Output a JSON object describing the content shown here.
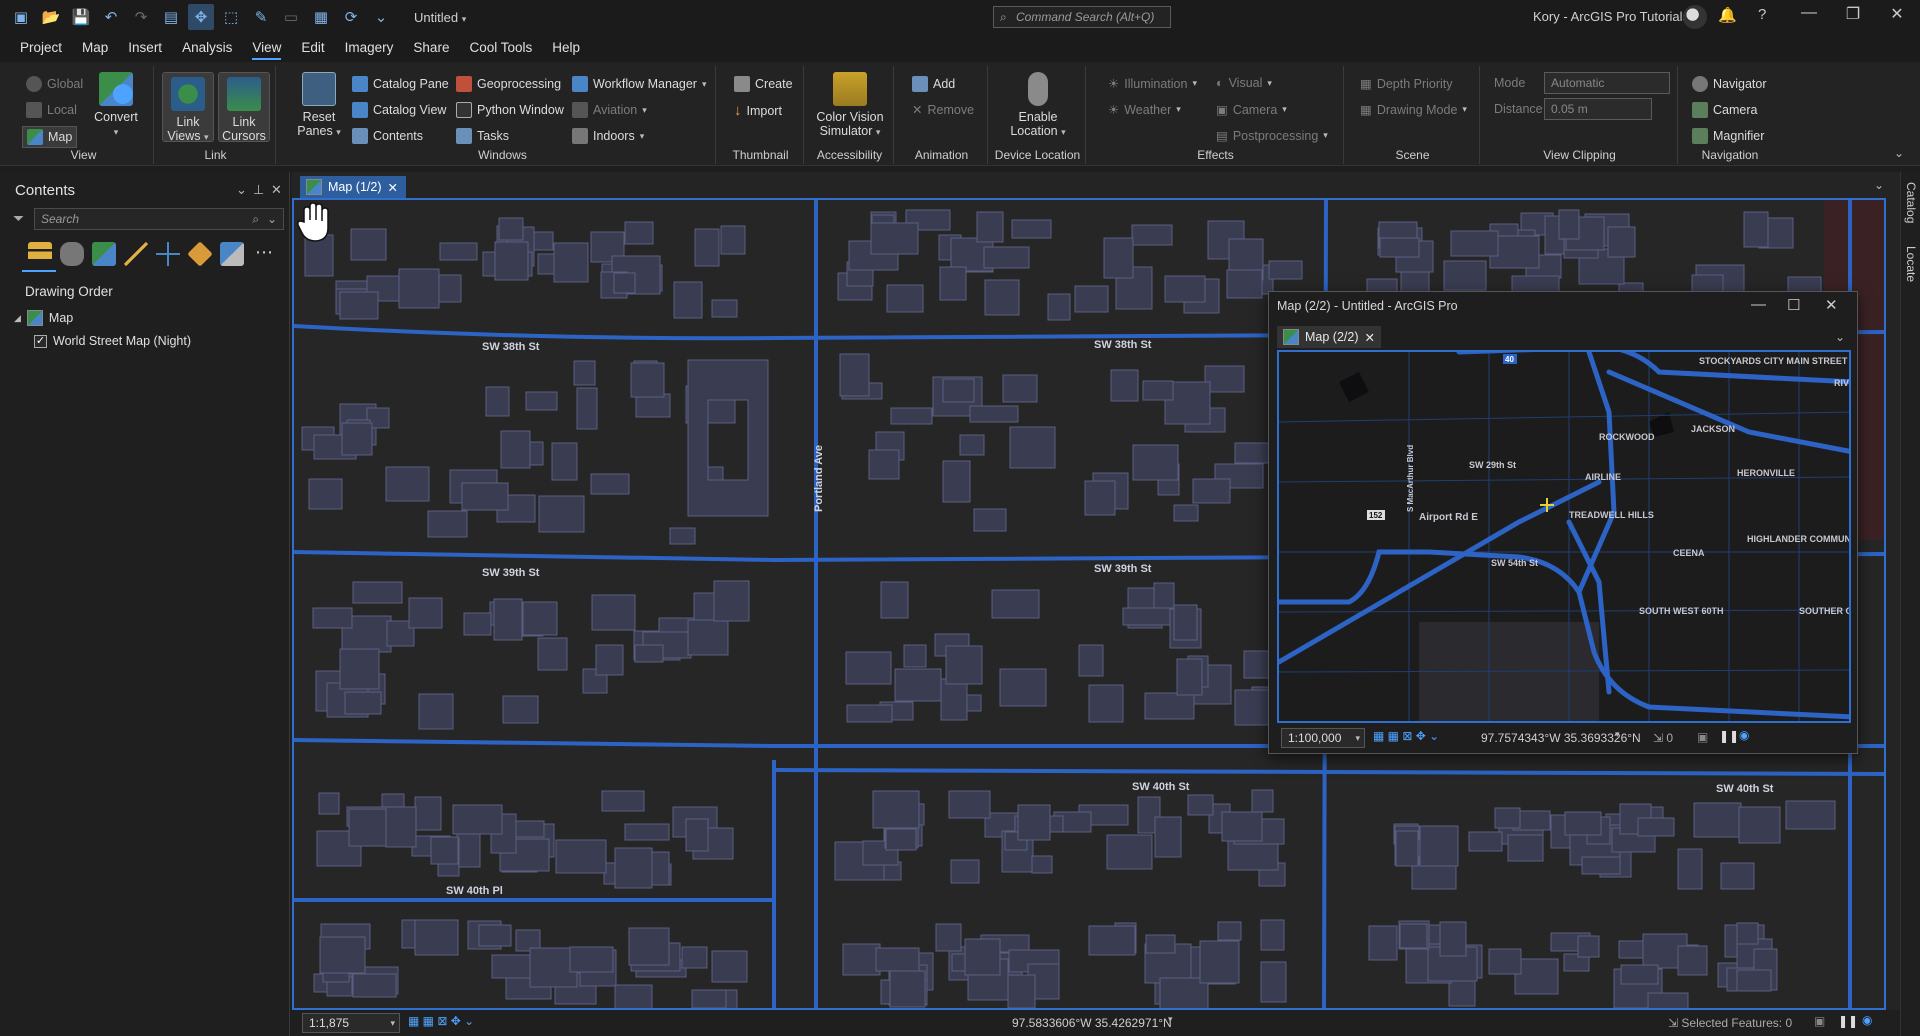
{
  "titlebar": {
    "doc_title": "Untitled",
    "command_search_placeholder": "Command Search (Alt+Q)",
    "user": "Kory - ArcGIS Pro Tutorials"
  },
  "menu": {
    "tabs": [
      "Project",
      "Map",
      "Insert",
      "Analysis",
      "View",
      "Edit",
      "Imagery",
      "Share",
      "Cool Tools",
      "Help"
    ],
    "active": "View"
  },
  "ribbon": {
    "view": {
      "label": "View",
      "global": "Global",
      "local": "Local",
      "map": "Map",
      "convert": "Convert"
    },
    "link": {
      "label": "Link",
      "link_views": "Link Views",
      "link_cursors": "Link Cursors"
    },
    "windows": {
      "label": "Windows",
      "reset_panes": "Reset Panes",
      "catalog_pane": "Catalog Pane",
      "catalog_view": "Catalog View",
      "contents": "Contents",
      "geoprocessing": "Geoprocessing",
      "python_window": "Python Window",
      "tasks": "Tasks",
      "workflow_manager": "Workflow Manager",
      "aviation": "Aviation",
      "indoors": "Indoors"
    },
    "thumbnail": {
      "label": "Thumbnail",
      "create": "Create",
      "import": "Import"
    },
    "accessibility": {
      "label": "Accessibility",
      "cvs": "Color Vision Simulator"
    },
    "animation": {
      "label": "Animation",
      "add": "Add",
      "remove": "Remove"
    },
    "device_location": {
      "label": "Device Location",
      "enable": "Enable Location"
    },
    "effects": {
      "label": "Effects",
      "illumination": "Illumination",
      "weather": "Weather",
      "visual": "Visual",
      "camera": "Camera",
      "postprocessing": "Postprocessing"
    },
    "scene": {
      "label": "Scene",
      "depth_priority": "Depth Priority",
      "drawing_mode": "Drawing Mode"
    },
    "view_clipping": {
      "label": "View Clipping",
      "mode": "Mode",
      "mode_value": "Automatic",
      "distance": "Distance",
      "distance_value": "0.05 m"
    },
    "navigation": {
      "label": "Navigation",
      "navigator": "Navigator",
      "camera": "Camera",
      "magnifier": "Magnifier"
    }
  },
  "contents": {
    "title": "Contents",
    "search_placeholder": "Search",
    "drawing_order": "Drawing Order",
    "map_item": "Map",
    "layer": "World Street Map (Night)"
  },
  "map1": {
    "tab": "Map (1/2)",
    "streets": {
      "sw38": "SW 38th St",
      "sw39": "SW 39th St",
      "sw40pl": "SW 40th Pl",
      "sw40": "SW 40th St",
      "portland": "Portland Ave"
    },
    "scale": "1:1,875",
    "coords": "97.5833606°W 35.4262971°N",
    "selected": "Selected Features: 0"
  },
  "map2": {
    "window_title": "Map (2/2) - Untitled - ArcGIS Pro",
    "tab": "Map (2/2)",
    "labels": {
      "stockyards": "STOCKYARDS CITY MAIN STREET",
      "rockwood": "ROCKWOOD",
      "jackson": "JACKSON",
      "heronville": "HERONVILLE",
      "airline": "AIRLINE",
      "treadwell": "TREADWELL HILLS",
      "highlander": "HIGHLANDER COMMUNITY SOUTH",
      "ceena": "CEENA",
      "swsixty": "SOUTH WEST 60TH",
      "southern_oaks": "SOUTHER OAKS",
      "riv": "RIV",
      "sw29": "SW 29th St",
      "sw54": "SW 54th St",
      "airport": "Airport Rd E",
      "macarthur": "S MacArthur Blvd",
      "i40": "40",
      "r152": "152"
    },
    "scale": "1:100,000",
    "coords": "97.7574343°W 35.3693326°N",
    "selected": "0"
  },
  "side_tabs": [
    "Catalog",
    "Locate"
  ]
}
